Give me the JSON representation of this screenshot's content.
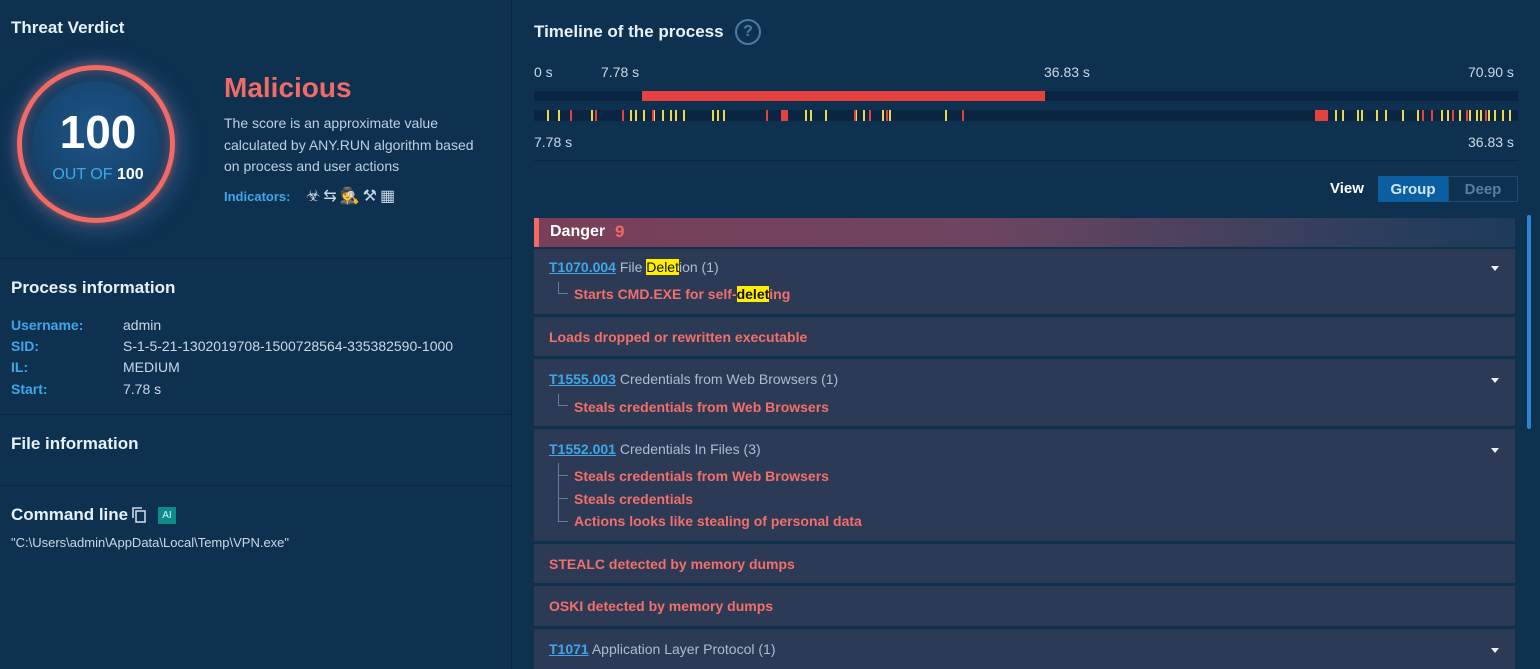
{
  "verdict": {
    "title": "Threat Verdict",
    "score": "100",
    "out_of_label": "OUT OF",
    "out_of_value": "100",
    "label": "Malicious",
    "description": "The score is an approximate value calculated by ANY.RUN algorithm based on process and user actions",
    "indicators_label": "Indicators:",
    "indicator_icons": [
      "biohazard-icon",
      "arrows-exchange-icon",
      "spy-icon",
      "tools-icon",
      "file-building-icon"
    ],
    "accent": "#f06a66"
  },
  "process": {
    "title": "Process information",
    "rows": [
      {
        "key": "Username:",
        "value": "admin"
      },
      {
        "key": "SID:",
        "value": "S-1-5-21-1302019708-1500728564-335382590-1000"
      },
      {
        "key": "IL:",
        "value": "MEDIUM"
      },
      {
        "key": "Start:",
        "value": "7.78 s"
      }
    ]
  },
  "file": {
    "title": "File information"
  },
  "command": {
    "title": "Command line",
    "ai_label": "AI",
    "value": "\"C:\\Users\\admin\\AppData\\Local\\Temp\\VPN.exe\""
  },
  "timeline": {
    "title": "Timeline of the process",
    "ticks_top": [
      "0 s",
      "7.78 s",
      "36.83 s",
      "70.90 s"
    ],
    "ticks_bottom": [
      "7.78 s",
      "36.83 s"
    ],
    "selection_start_fraction": 0.11,
    "selection_end_fraction": 0.52
  },
  "view": {
    "label": "View",
    "options": [
      "Group",
      "Deep"
    ],
    "selected": "Group"
  },
  "danger": {
    "label": "Danger",
    "count": "9",
    "items": [
      {
        "id": "T1070.004",
        "name_pre": "File ",
        "name_hl": "Delet",
        "name_post": "ion (1)",
        "subs": [
          {
            "pre": "Starts CMD.EXE for self-",
            "hl": "delet",
            "post": "ing"
          }
        ]
      },
      {
        "text": "Loads dropped or rewritten executable"
      },
      {
        "id": "T1555.003",
        "name": "Credentials from Web Browsers (1)",
        "subs": [
          "Steals credentials from Web Browsers"
        ]
      },
      {
        "id": "T1552.001",
        "name": "Credentials In Files (3)",
        "subs": [
          "Steals credentials from Web Browsers",
          "Steals credentials",
          "Actions looks like stealing of personal data"
        ]
      },
      {
        "text": "STEALC detected by memory dumps"
      },
      {
        "text": "OSKI detected by memory dumps"
      },
      {
        "id": "T1071",
        "name": "Application Layer Protocol (1)"
      }
    ]
  }
}
